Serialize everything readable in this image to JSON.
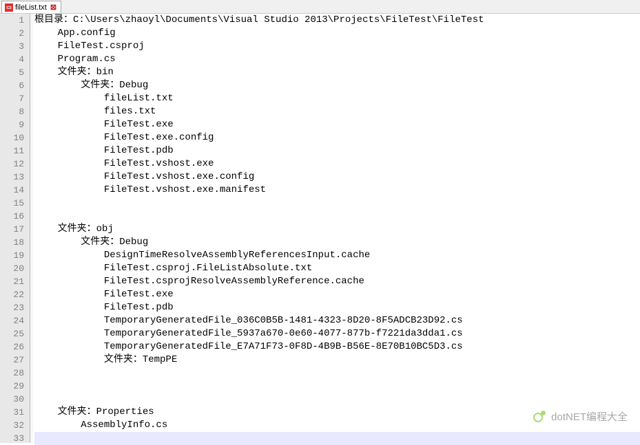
{
  "tab": {
    "filename": "fileList.txt"
  },
  "watermark": {
    "text": "dotNET编程大全"
  },
  "code": {
    "lines": [
      "根目录：C:\\Users\\zhaoyl\\Documents\\Visual Studio 2013\\Projects\\FileTest\\FileTest",
      "    App.config",
      "    FileTest.csproj",
      "    Program.cs",
      "    文件夹：bin",
      "        文件夹：Debug",
      "            fileList.txt",
      "            files.txt",
      "            FileTest.exe",
      "            FileTest.exe.config",
      "            FileTest.pdb",
      "            FileTest.vshost.exe",
      "            FileTest.vshost.exe.config",
      "            FileTest.vshost.exe.manifest",
      "",
      "",
      "    文件夹：obj",
      "        文件夹：Debug",
      "            DesignTimeResolveAssemblyReferencesInput.cache",
      "            FileTest.csproj.FileListAbsolute.txt",
      "            FileTest.csprojResolveAssemblyReference.cache",
      "            FileTest.exe",
      "            FileTest.pdb",
      "            TemporaryGeneratedFile_036C0B5B-1481-4323-8D20-8F5ADCB23D92.cs",
      "            TemporaryGeneratedFile_5937a670-0e60-4077-877b-f7221da3dda1.cs",
      "            TemporaryGeneratedFile_E7A71F73-0F8D-4B9B-B56E-8E70B10BC5D3.cs",
      "            文件夹：TempPE",
      "",
      "",
      "",
      "    文件夹：Properties",
      "        AssemblyInfo.cs",
      ""
    ],
    "highlightedLine": 33
  }
}
